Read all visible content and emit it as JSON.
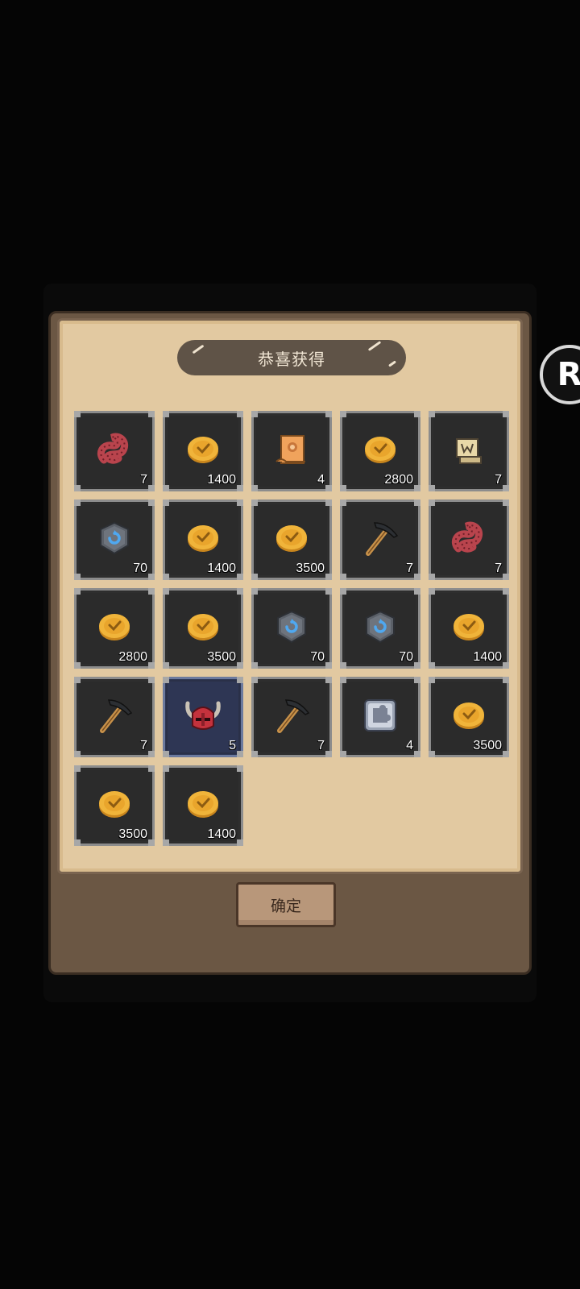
{
  "dialog": {
    "title": "恭喜获得",
    "confirm_label": "确定"
  },
  "side_button": {
    "glyph": "R",
    "icon": "floating-assist-icon"
  },
  "colors": {
    "coin": "#f0b43a",
    "worm": "#b9444d",
    "rune": "#4fa8f0",
    "highlight_slot": "#2e3654"
  },
  "rewards": [
    {
      "icon": "worm",
      "qty": "7"
    },
    {
      "icon": "gold-coin",
      "qty": "1400"
    },
    {
      "icon": "scroll",
      "qty": "4"
    },
    {
      "icon": "gold-coin",
      "qty": "2800"
    },
    {
      "icon": "blueprint",
      "qty": "7"
    },
    {
      "icon": "rune-stone",
      "qty": "70"
    },
    {
      "icon": "gold-coin",
      "qty": "1400"
    },
    {
      "icon": "gold-coin",
      "qty": "3500"
    },
    {
      "icon": "pickaxe",
      "qty": "7"
    },
    {
      "icon": "worm",
      "qty": "7"
    },
    {
      "icon": "gold-coin",
      "qty": "2800"
    },
    {
      "icon": "gold-coin",
      "qty": "3500"
    },
    {
      "icon": "rune-stone",
      "qty": "70"
    },
    {
      "icon": "rune-stone",
      "qty": "70"
    },
    {
      "icon": "gold-coin",
      "qty": "1400"
    },
    {
      "icon": "pickaxe",
      "qty": "7"
    },
    {
      "icon": "horned-helmet",
      "qty": "5",
      "highlight": true
    },
    {
      "icon": "pickaxe",
      "qty": "7"
    },
    {
      "icon": "puzzle-tile",
      "qty": "4"
    },
    {
      "icon": "gold-coin",
      "qty": "3500"
    },
    {
      "icon": "gold-coin",
      "qty": "3500"
    },
    {
      "icon": "gold-coin",
      "qty": "1400"
    }
  ]
}
